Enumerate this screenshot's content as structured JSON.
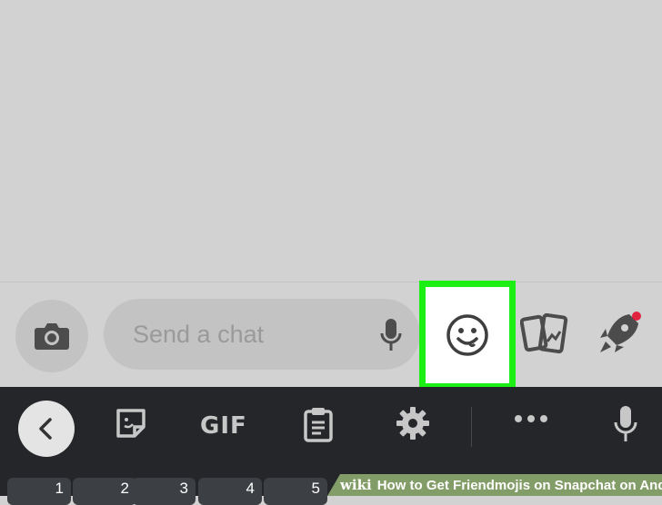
{
  "chat": {
    "placeholder": "Send a chat"
  },
  "toolbar": {
    "gif_label": "GIF"
  },
  "number_keys": [
    "1",
    "2",
    "3",
    "4",
    "5"
  ],
  "watermark": {
    "brand": "wiki",
    "caption": "How to Get Friendmojis on Snapchat on Android"
  },
  "colors": {
    "highlight": "#1bef13",
    "notification_dot": "#e0233e",
    "keyboard_bg": "#242629"
  },
  "icons": [
    "camera-icon",
    "microphone-icon",
    "smiley-face-icon",
    "sticker-cards-icon",
    "rocket-icon",
    "chevron-left-icon",
    "sticker-icon",
    "clipboard-icon",
    "settings-gear-icon",
    "more-dots-icon",
    "voice-input-icon"
  ]
}
